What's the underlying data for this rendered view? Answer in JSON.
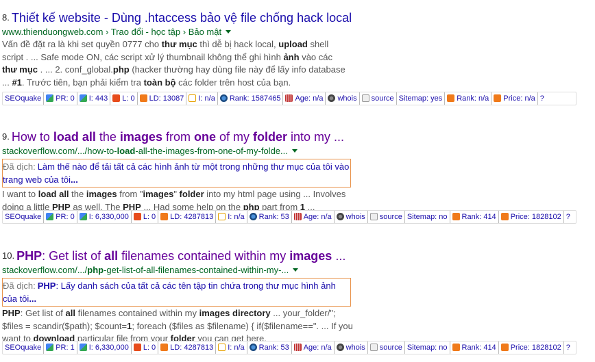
{
  "results": [
    {
      "number": "8.",
      "title_parts": [
        "Thiết kế website - Dùng .htaccess bảo vệ file chống hack local"
      ],
      "url_parts": [
        "www.thienduongweb.com › Trao đổi - học tập › Bảo mật"
      ],
      "snippet_lines": [
        [
          "Vấn đề đặt ra là khi set quyền 0777 cho ",
          "thư mục",
          " thì dễ bị hack local, ",
          "upload",
          " shell"
        ],
        [
          "script . ... Safe mode ON, các script xử lý thumbnail không thể ghi hình ",
          "ảnh",
          " vào các"
        ],
        [
          "thư mục",
          " . ... 2. conf_global.",
          "php",
          " (hacker thường hay dùng file này để lấy info database"
        ],
        [
          "... ",
          "#1",
          ". Trước tiên, bạn phải kiểm tra ",
          "toàn bộ",
          " các folder trên host của bạn."
        ]
      ]
    },
    {
      "number": "9.",
      "title_parts": [
        "How to ",
        "load all",
        " the ",
        "images",
        " from ",
        "one",
        " of my ",
        "folder",
        " into my ..."
      ],
      "url_parts": [
        "stackoverflow.com/.../how-to-",
        "load",
        "-all-the-images-from-one-of-my-folde..."
      ],
      "translation_prefix": "Đã dịch:",
      "translation_lines": [
        [
          "Làm thế nào để tải tất cả các hình ảnh từ một trong những thư mục của tôi vào"
        ],
        [
          "trang web của tôi",
          "..."
        ]
      ],
      "snippet_lines": [
        [
          "I want to ",
          "load all",
          " the ",
          "images",
          " from \"",
          "images",
          "\" ",
          "folder",
          " into my html page using ... Involves"
        ],
        [
          "doing a little ",
          "PHP",
          " as well. The ",
          "PHP",
          " ... Had some help on the ",
          "php",
          " part from ",
          "1",
          " ..."
        ]
      ]
    },
    {
      "number": "10.",
      "title_parts": [
        "PHP",
        ": Get list of ",
        "all",
        " filenames contained within my ",
        "images",
        " ..."
      ],
      "url_parts": [
        "stackoverflow.com/.../",
        "php",
        "-get-list-of-all-filenames-contained-within-my-..."
      ],
      "translation_prefix": "Đã dịch:",
      "translation_lines": [
        [
          "PHP",
          ": Lấy danh sách của tất cả các tên tập tin chứa trong thư mục hình ảnh"
        ],
        [
          "của tôi",
          "..."
        ]
      ],
      "snippet_lines": [
        [
          "PHP",
          ": Get list of ",
          "all",
          " filenames contained within my ",
          "images directory",
          " ... your_folder/\";"
        ],
        [
          "$files = scandir($path); $count=",
          "1",
          "; foreach ($files as $filename) { if($filename==\". ... If you"
        ],
        [
          "want to ",
          "download",
          " particular file from your ",
          "folder",
          " you can get here."
        ]
      ]
    }
  ],
  "seoquake_bars": [
    {
      "label": "SEOquake",
      "pr": "PR: 0",
      "i_google": "I: 443",
      "l": "L: 0",
      "ld": "LD: 13087",
      "i_yahoo": "I: n/a",
      "rank": "Rank: 1587465",
      "age": "Age: n/a",
      "whois": "whois",
      "source": "source",
      "sitemap": "Sitemap: yes",
      "alexa_rank": "Rank: n/a",
      "price": "Price: n/a",
      "help": "?"
    },
    {
      "label": "SEOquake",
      "pr": "PR: 0",
      "i_google": "I: 6,330,000",
      "l": "L: 0",
      "ld": "LD: 4287813",
      "i_yahoo": "I: n/a",
      "rank": "Rank: 53",
      "age": "Age: n/a",
      "whois": "whois",
      "source": "source",
      "sitemap": "Sitemap: no",
      "alexa_rank": "Rank: 414",
      "price": "Price: 1828102",
      "help": "?"
    },
    {
      "label": "SEOquake",
      "pr": "PR: 1",
      "i_google": "I: 6,330,000",
      "l": "L: 0",
      "ld": "LD: 4287813",
      "i_yahoo": "I: n/a",
      "rank": "Rank: 53",
      "age": "Age: n/a",
      "whois": "whois",
      "source": "source",
      "sitemap": "Sitemap: no",
      "alexa_rank": "Rank: 414",
      "price": "Price: 1828102",
      "help": "?"
    }
  ],
  "colors": {
    "title_link": "#1a0dab",
    "visited_link": "#660099",
    "url_green": "#006621",
    "snippet_gray": "#545454",
    "translation_border": "#e8924a"
  }
}
